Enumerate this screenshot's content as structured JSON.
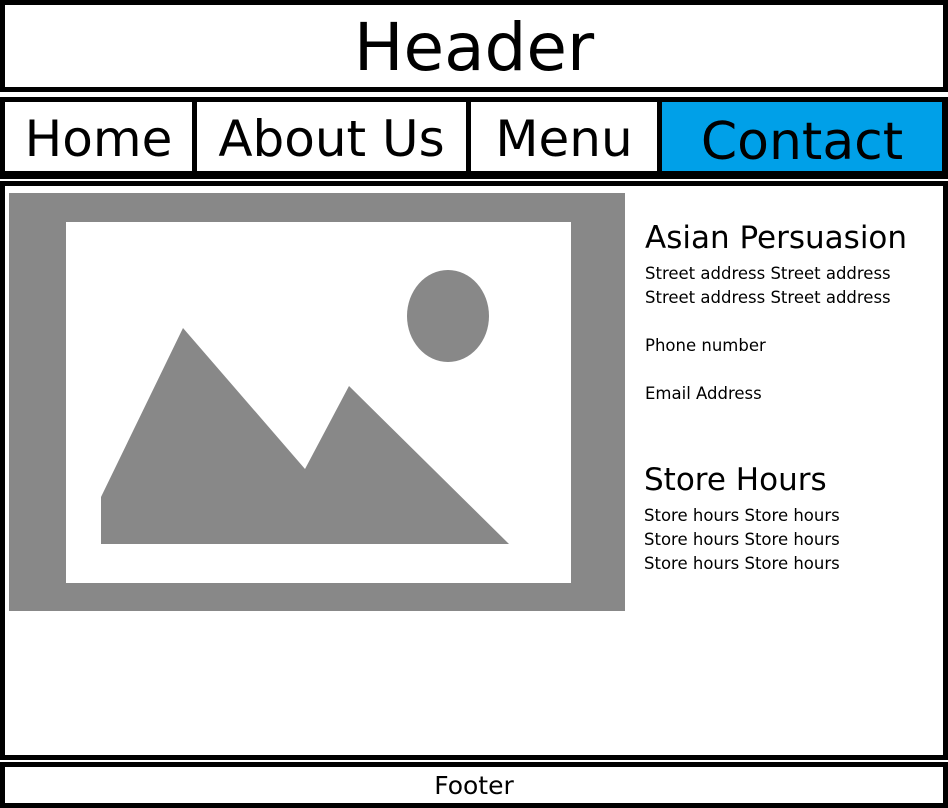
{
  "header": {
    "title": "Header"
  },
  "nav": {
    "items": [
      {
        "label": "Home"
      },
      {
        "label": "About Us"
      },
      {
        "label": "Menu"
      },
      {
        "label": "Contact",
        "active": true
      }
    ],
    "active_color": "#00a0e8"
  },
  "main": {
    "image": {
      "icon": "image-placeholder-icon",
      "color": "#888888"
    },
    "contact": {
      "name": "Asian Persuasion",
      "address_lines": [
        "Street address Street address",
        "Street address Street address"
      ],
      "phone": "Phone number",
      "email": "Email Address"
    },
    "hours": {
      "title": "Store Hours",
      "lines": [
        "Store hours Store hours",
        "Store hours Store hours",
        "Store hours Store hours"
      ]
    }
  },
  "footer": {
    "text": "Footer"
  }
}
